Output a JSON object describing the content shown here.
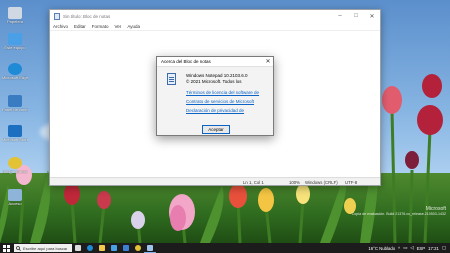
{
  "desktop": {
    "icons": [
      {
        "label": "Papelera",
        "icon": "recycle-bin-icon",
        "color": "#cfd8e3"
      },
      {
        "label": "Este equipo",
        "icon": "computer-icon",
        "color": "#4aa0e6"
      },
      {
        "label": "Microsoft Edge",
        "icon": "edge-icon",
        "color": "#1f8ad6"
      },
      {
        "label": "Panel de control",
        "icon": "control-panel-icon",
        "color": "#3a7cc2"
      },
      {
        "label": "Microsoft Store",
        "icon": "store-icon",
        "color": "#1d6fc0"
      },
      {
        "label": "Google Chrome",
        "icon": "chrome-icon",
        "color": "#e4c235"
      },
      {
        "label": "Acceso",
        "icon": "shortcut-icon",
        "color": "#8fb4da"
      }
    ]
  },
  "notepad": {
    "title": "Sin título: Bloc de notas",
    "menu": [
      "Archivo",
      "Editar",
      "Formato",
      "Ver",
      "Ayuda"
    ],
    "status": {
      "position": "Ln 1, Col 1",
      "zoom": "100%",
      "line_ending": "Windows (CRLF)",
      "encoding": "UTF-8"
    }
  },
  "about_dialog": {
    "title": "Acerca del Bloc de notas",
    "product": "Windows Notepad 10.2103.6.0",
    "copyright": "© 2021 Microsoft. Todos los",
    "links": [
      "Términos de licencia del software de",
      "Contrato de servicios de Microsoft",
      "Declaración de privacidad de"
    ],
    "ok_label": "Aceptar"
  },
  "watermark": {
    "line1": "Microsoft",
    "line2": "Copia de evaluación. Build 21376.co_release.210503-1432"
  },
  "taskbar": {
    "search_placeholder": "Escribe aquí para buscar",
    "apps": [
      {
        "icon": "task-view-icon",
        "color": "#dddddd"
      },
      {
        "icon": "edge-icon",
        "color": "#1f8ad6"
      },
      {
        "icon": "file-explorer-icon",
        "color": "#f2c94c"
      },
      {
        "icon": "store-icon",
        "color": "#4aa0e6"
      },
      {
        "icon": "mail-icon",
        "color": "#3d7fd1"
      },
      {
        "icon": "chrome-icon",
        "color": "#e4c235"
      },
      {
        "icon": "notepad-icon",
        "color": "#9fc4ea"
      }
    ],
    "weather": "16°C Nublado",
    "language": "ESP",
    "time": "17:21"
  },
  "colors": {
    "link": "#0b63c5",
    "taskbar": "#1c1c1c",
    "accent": "#0b63c5"
  }
}
